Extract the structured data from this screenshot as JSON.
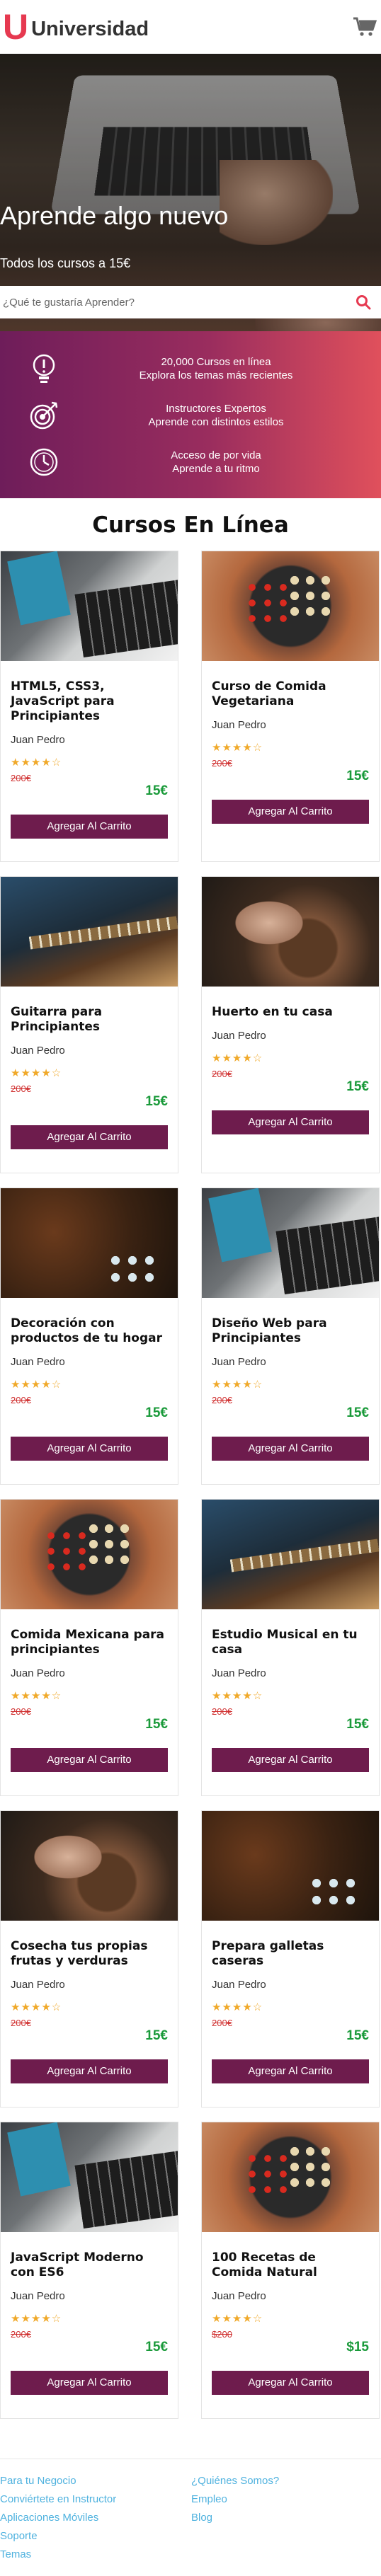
{
  "brand": {
    "logo_letter": "U",
    "name": "Universidad",
    "accent": "#e63950"
  },
  "hero": {
    "title": "Aprende algo nuevo",
    "subtitle": "Todos los cursos a 15€",
    "search_placeholder": "¿Qué te gustaría Aprender?"
  },
  "features": [
    {
      "icon": "lightbulb-icon",
      "line1": "20,000 Cursos en línea",
      "line2": "Explora los temas más recientes"
    },
    {
      "icon": "target-icon",
      "line1": "Instructores Expertos",
      "line2": "Aprende con distintos estilos"
    },
    {
      "icon": "clock-icon",
      "line1": "Acceso de por vida",
      "line2": "Aprende a tu ritmo"
    }
  ],
  "section_title": "Cursos En Línea",
  "courses": [
    {
      "title": "HTML5, CSS3, JavaScript para Principiantes",
      "author": "Juan Pedro",
      "stars": "★★★★☆",
      "old_price": "200€",
      "price": "15€",
      "button": "Agregar Al Carrito",
      "thumb": "t-web"
    },
    {
      "title": "Curso de Comida Vegetariana",
      "author": "Juan Pedro",
      "stars": "★★★★☆",
      "old_price": "200€",
      "price": "15€",
      "button": "Agregar Al Carrito",
      "thumb": "t-food"
    },
    {
      "title": "Guitarra para Principiantes",
      "author": "Juan Pedro",
      "stars": "★★★★☆",
      "old_price": "200€",
      "price": "15€",
      "button": "Agregar Al Carrito",
      "thumb": "t-guitar"
    },
    {
      "title": "Huerto en tu casa",
      "author": "Juan Pedro",
      "stars": "★★★★☆",
      "old_price": "200€",
      "price": "15€",
      "button": "Agregar Al Carrito",
      "thumb": "t-garden"
    },
    {
      "title": "Decoración con productos de tu hogar",
      "author": "Juan Pedro",
      "stars": "★★★★☆",
      "old_price": "200€",
      "price": "15€",
      "button": "Agregar Al Carrito",
      "thumb": "t-xmas"
    },
    {
      "title": "Diseño Web para Principiantes",
      "author": "Juan Pedro",
      "stars": "★★★★☆",
      "old_price": "200€",
      "price": "15€",
      "button": "Agregar Al Carrito",
      "thumb": "t-web"
    },
    {
      "title": "Comida Mexicana para principiantes",
      "author": "Juan Pedro",
      "stars": "★★★★☆",
      "old_price": "200€",
      "price": "15€",
      "button": "Agregar Al Carrito",
      "thumb": "t-food"
    },
    {
      "title": "Estudio Musical en tu casa",
      "author": "Juan Pedro",
      "stars": "★★★★☆",
      "old_price": "200€",
      "price": "15€",
      "button": "Agregar Al Carrito",
      "thumb": "t-guitar"
    },
    {
      "title": "Cosecha tus propias frutas y verduras",
      "author": "Juan Pedro",
      "stars": "★★★★☆",
      "old_price": "200€",
      "price": "15€",
      "button": "Agregar Al Carrito",
      "thumb": "t-garden"
    },
    {
      "title": "Prepara galletas caseras",
      "author": "Juan Pedro",
      "stars": "★★★★☆",
      "old_price": "200€",
      "price": "15€",
      "button": "Agregar Al Carrito",
      "thumb": "t-xmas"
    },
    {
      "title": "JavaScript Moderno con ES6",
      "author": "Juan Pedro",
      "stars": "★★★★☆",
      "old_price": "200€",
      "price": "15€",
      "button": "Agregar Al Carrito",
      "thumb": "t-web"
    },
    {
      "title": "100 Recetas de Comida Natural",
      "author": "Juan Pedro",
      "stars": "★★★★☆",
      "old_price": "$200",
      "price": "$15",
      "button": "Agregar Al Carrito",
      "thumb": "t-food"
    }
  ],
  "footer": {
    "col1": [
      "Para tu Negocio",
      "Conviértete en Instructor",
      "Aplicaciones Móviles",
      "Soporte",
      "Temas"
    ],
    "col2": [
      "¿Quiénes Somos?",
      "Empleo",
      "Blog"
    ]
  },
  "colors": {
    "button": "#6e1c4d",
    "price": "#1a9a3a",
    "old_price": "#d03030",
    "star": "#f0a92a",
    "link": "#4fb2df"
  }
}
